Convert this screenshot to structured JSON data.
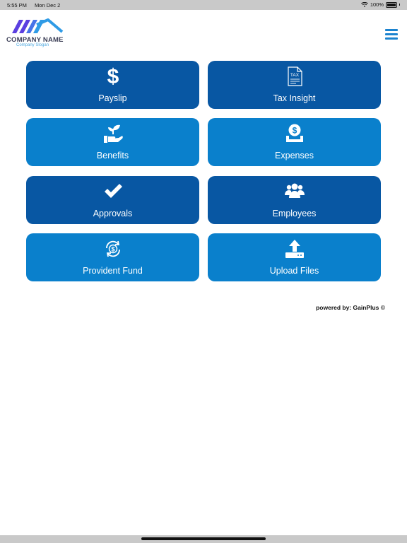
{
  "status_bar": {
    "time": "5:55 PM",
    "date": "Mon Dec 2",
    "battery": "100%"
  },
  "brand": {
    "name": "COMPANY NAME",
    "slogan": "Company Slogan",
    "colors": {
      "purple": "#5b3fe0",
      "blue": "#2f9be6"
    }
  },
  "menu": {
    "icon": "hamburger-icon"
  },
  "tiles": [
    {
      "label": "Payslip",
      "icon": "dollar-icon",
      "color": "#0857a3"
    },
    {
      "label": "Tax Insight",
      "icon": "tax-document-icon",
      "color": "#0857a3"
    },
    {
      "label": "Benefits",
      "icon": "hand-plant-icon",
      "color": "#0a80cc"
    },
    {
      "label": "Expenses",
      "icon": "money-tray-icon",
      "color": "#0a80cc"
    },
    {
      "label": "Approvals",
      "icon": "checkmark-icon",
      "color": "#0857a3"
    },
    {
      "label": "Employees",
      "icon": "users-icon",
      "color": "#0857a3"
    },
    {
      "label": "Provident Fund",
      "icon": "dollar-cycle-icon",
      "color": "#0a80cc"
    },
    {
      "label": "Upload Files",
      "icon": "upload-icon",
      "color": "#0a80cc"
    }
  ],
  "footer": {
    "powered_by": "powered by: GainPlus ©"
  }
}
